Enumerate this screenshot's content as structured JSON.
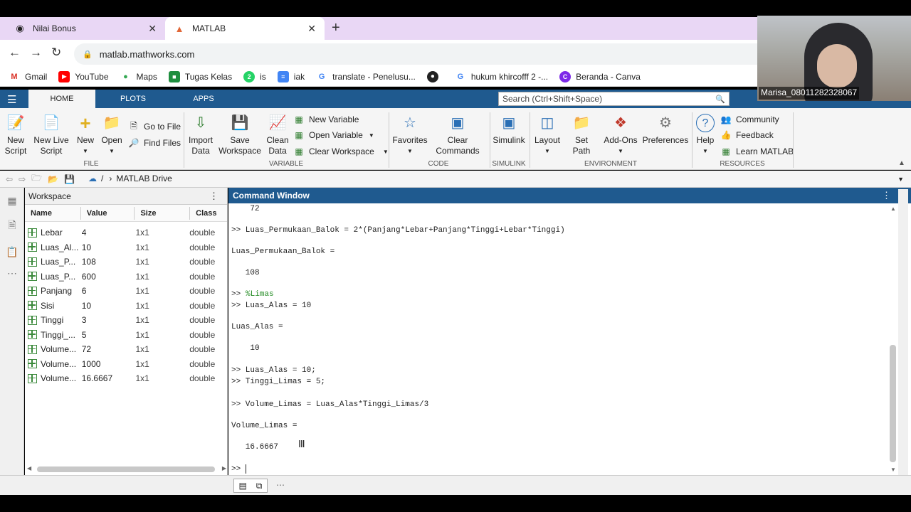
{
  "browser": {
    "tabs": [
      {
        "title": "Nilai Bonus",
        "icon": "github-icon"
      },
      {
        "title": "MATLAB",
        "icon": "matlab-logo-icon"
      }
    ],
    "url": "matlab.mathworks.com",
    "bookmarks": [
      {
        "label": "Gmail",
        "icon": "gmail-icon"
      },
      {
        "label": "YouTube",
        "icon": "youtube-icon"
      },
      {
        "label": "Maps",
        "icon": "maps-icon"
      },
      {
        "label": "Tugas Kelas",
        "icon": "classroom-icon"
      },
      {
        "label": "is",
        "icon": "whatsapp-icon"
      },
      {
        "label": "iak",
        "icon": "docs-icon"
      },
      {
        "label": "translate - Penelusu...",
        "icon": "google-icon"
      },
      {
        "label": "",
        "icon": "globe-icon"
      },
      {
        "label": "hukum khircofff 2 -...",
        "icon": "google-icon"
      },
      {
        "label": "Beranda - Canva",
        "icon": "canva-icon"
      }
    ]
  },
  "matlab": {
    "tabs": [
      "HOME",
      "PLOTS",
      "APPS"
    ],
    "search_placeholder": "Search (Ctrl+Shift+Space)",
    "ribbon": {
      "new_script": "New Script",
      "new_live_script": "New Live Script",
      "new": "New",
      "open": "Open",
      "go_to_file": "Go to File",
      "find_files": "Find Files",
      "import_data": "Import Data",
      "save_workspace": "Save Workspace",
      "clean_data": "Clean Data",
      "new_variable": "New Variable",
      "open_variable": "Open Variable",
      "clear_workspace": "Clear Workspace",
      "favorites": "Favorites",
      "clear_commands": "Clear Commands",
      "simulink": "Simulink",
      "layout": "Layout",
      "set_path": "Set Path",
      "add_ons": "Add-Ons",
      "preferences": "Preferences",
      "help": "Help",
      "community": "Community",
      "feedback": "Feedback",
      "learn_matlab": "Learn MATLAB",
      "groups": {
        "file": "FILE",
        "variable": "VARIABLE",
        "code": "CODE",
        "simulink": "SIMULINK",
        "environment": "ENVIRONMENT",
        "resources": "RESOURCES"
      }
    },
    "path": "MATLAB Drive",
    "workspace": {
      "title": "Workspace",
      "columns": [
        "Name",
        "Value",
        "Size",
        "Class"
      ],
      "rows": [
        {
          "name": "Lebar",
          "value": "4",
          "size": "1x1",
          "class": "double"
        },
        {
          "name": "Luas_Al...",
          "value": "10",
          "size": "1x1",
          "class": "double"
        },
        {
          "name": "Luas_P...",
          "value": "108",
          "size": "1x1",
          "class": "double"
        },
        {
          "name": "Luas_P...",
          "value": "600",
          "size": "1x1",
          "class": "double"
        },
        {
          "name": "Panjang",
          "value": "6",
          "size": "1x1",
          "class": "double"
        },
        {
          "name": "Sisi",
          "value": "10",
          "size": "1x1",
          "class": "double"
        },
        {
          "name": "Tinggi",
          "value": "3",
          "size": "1x1",
          "class": "double"
        },
        {
          "name": "Tinggi_...",
          "value": "5",
          "size": "1x1",
          "class": "double"
        },
        {
          "name": "Volume...",
          "value": "72",
          "size": "1x1",
          "class": "double"
        },
        {
          "name": "Volume...",
          "value": "1000",
          "size": "1x1",
          "class": "double"
        },
        {
          "name": "Volume...",
          "value": "16.6667",
          "size": "1x1",
          "class": "double"
        }
      ]
    },
    "command_window": {
      "title": "Command Window",
      "lines": [
        "    72",
        ">> Luas_Permukaan_Balok = 2*(Panjang*Lebar+Panjang*Tinggi+Lebar*Tinggi)",
        "Luas_Permukaan_Balok =",
        "   108",
        ">> ",
        "%Limas",
        ">> Luas_Alas = 10",
        "Luas_Alas =",
        "    10",
        ">> Luas_Alas = 10;",
        ">> Tinggi_Limas = 5;",
        ">> Volume_Limas = Luas_Alas*Tinggi_Limas/3",
        "Volume_Limas =",
        "   16.6667",
        ">> "
      ]
    }
  },
  "webcam": {
    "label": "Marisa_08011282328067"
  }
}
